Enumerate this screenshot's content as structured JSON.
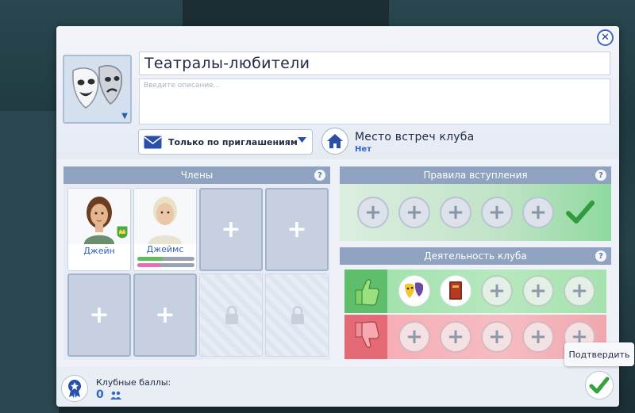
{
  "club": {
    "name": "Театралы-любители",
    "description_placeholder": "Введите описание..."
  },
  "access": {
    "label": "Только по приглашениям"
  },
  "venue": {
    "title": "Место встреч клуба",
    "value": "Нет"
  },
  "members": {
    "header": "Члены",
    "help": "?",
    "list": [
      {
        "name": "Джейн",
        "leader": true
      },
      {
        "name": "Джеймс",
        "leader": false,
        "bars": [
          {
            "color": "#5bbf5b",
            "value": 0.45
          },
          {
            "color": "#e46fb5",
            "value": 0.4
          }
        ]
      }
    ],
    "add_symbol": "+"
  },
  "rules": {
    "header": "Правила вступления",
    "help": "?",
    "slots": 5
  },
  "activities": {
    "header": "Деятельность клуба",
    "help": "?"
  },
  "bottom": {
    "points_label": "Клубные баллы:",
    "points_value": "0"
  },
  "confirm": {
    "tooltip": "Подтвердить"
  },
  "colors": {
    "accent": "#3466c9",
    "confirm_check": "#37a13e",
    "rules_check": "#2e9b3c"
  }
}
